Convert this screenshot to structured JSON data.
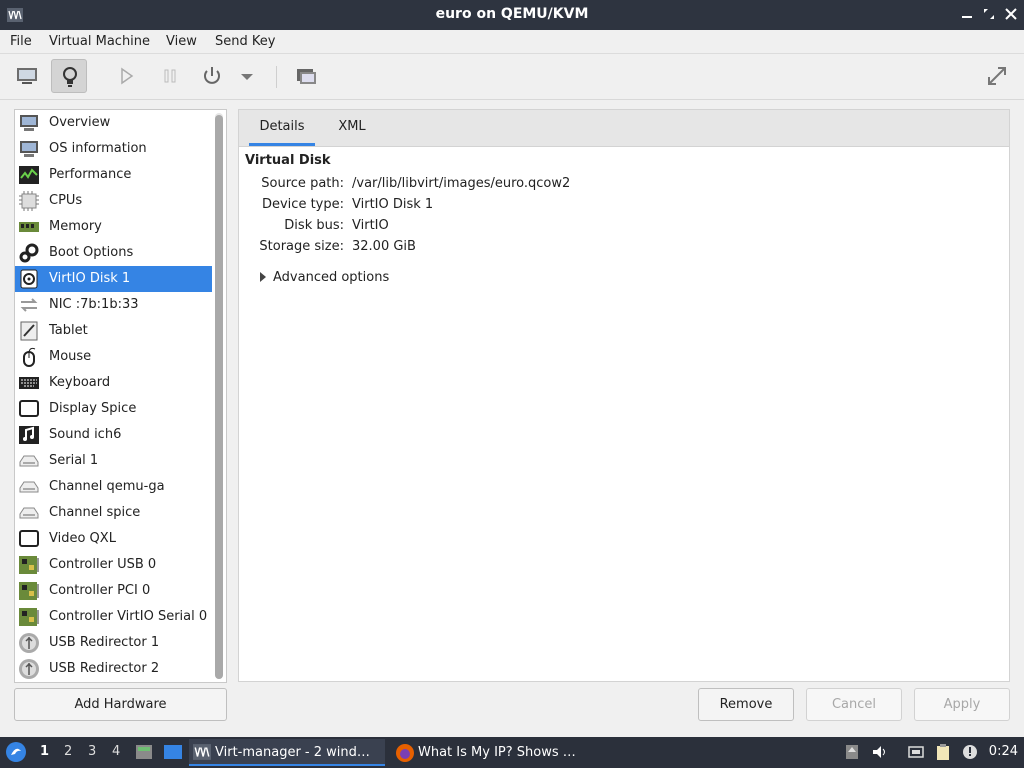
{
  "window": {
    "title": "euro on QEMU/KVM"
  },
  "menu": [
    "File",
    "Virtual Machine",
    "View",
    "Send Key"
  ],
  "sidebar": {
    "items": [
      {
        "label": "Overview",
        "icon": "monitor-icon"
      },
      {
        "label": "OS information",
        "icon": "monitor-icon"
      },
      {
        "label": "Performance",
        "icon": "performance-graph-icon"
      },
      {
        "label": "CPUs",
        "icon": "cpu-chip-icon"
      },
      {
        "label": "Memory",
        "icon": "memory-module-icon"
      },
      {
        "label": "Boot Options",
        "icon": "gears-icon"
      },
      {
        "label": "VirtIO Disk 1",
        "icon": "disk-icon",
        "selected": true
      },
      {
        "label": "NIC :7b:1b:33",
        "icon": "network-arrows-icon"
      },
      {
        "label": "Tablet",
        "icon": "tablet-icon"
      },
      {
        "label": "Mouse",
        "icon": "mouse-icon"
      },
      {
        "label": "Keyboard",
        "icon": "keyboard-icon"
      },
      {
        "label": "Display Spice",
        "icon": "display-icon"
      },
      {
        "label": "Sound ich6",
        "icon": "sound-icon"
      },
      {
        "label": "Serial 1",
        "icon": "serial-port-icon"
      },
      {
        "label": "Channel qemu-ga",
        "icon": "channel-icon"
      },
      {
        "label": "Channel spice",
        "icon": "channel-icon"
      },
      {
        "label": "Video QXL",
        "icon": "video-icon"
      },
      {
        "label": "Controller USB 0",
        "icon": "controller-card-icon"
      },
      {
        "label": "Controller PCI 0",
        "icon": "controller-card-icon"
      },
      {
        "label": "Controller VirtIO Serial 0",
        "icon": "controller-card-icon"
      },
      {
        "label": "USB Redirector 1",
        "icon": "usb-icon"
      },
      {
        "label": "USB Redirector 2",
        "icon": "usb-icon"
      }
    ],
    "add_button": "Add Hardware"
  },
  "tabs": [
    "Details",
    "XML"
  ],
  "details": {
    "section_title": "Virtual Disk",
    "properties": [
      {
        "label": "Source path:",
        "value": "/var/lib/libvirt/images/euro.qcow2"
      },
      {
        "label": "Device type:",
        "value": "VirtIO Disk 1"
      },
      {
        "label": "Disk bus:",
        "value": "VirtIO"
      },
      {
        "label": "Storage size:",
        "value": "32.00 GiB"
      }
    ],
    "advanced": "Advanced options"
  },
  "buttons": {
    "remove": "Remove",
    "cancel": "Cancel",
    "apply": "Apply"
  },
  "taskbar": {
    "workspaces": [
      "1",
      "2",
      "3",
      "4"
    ],
    "tasks": [
      {
        "label": "Virt-manager - 2 wind…",
        "icon": "virt-manager-icon"
      },
      {
        "label": "What Is My IP? Shows …",
        "icon": "firefox-icon"
      }
    ],
    "clock": "0:24"
  },
  "colors": {
    "selection": "#3584e4",
    "titlebar": "#2e3440",
    "taskbar": "#2b303b"
  }
}
